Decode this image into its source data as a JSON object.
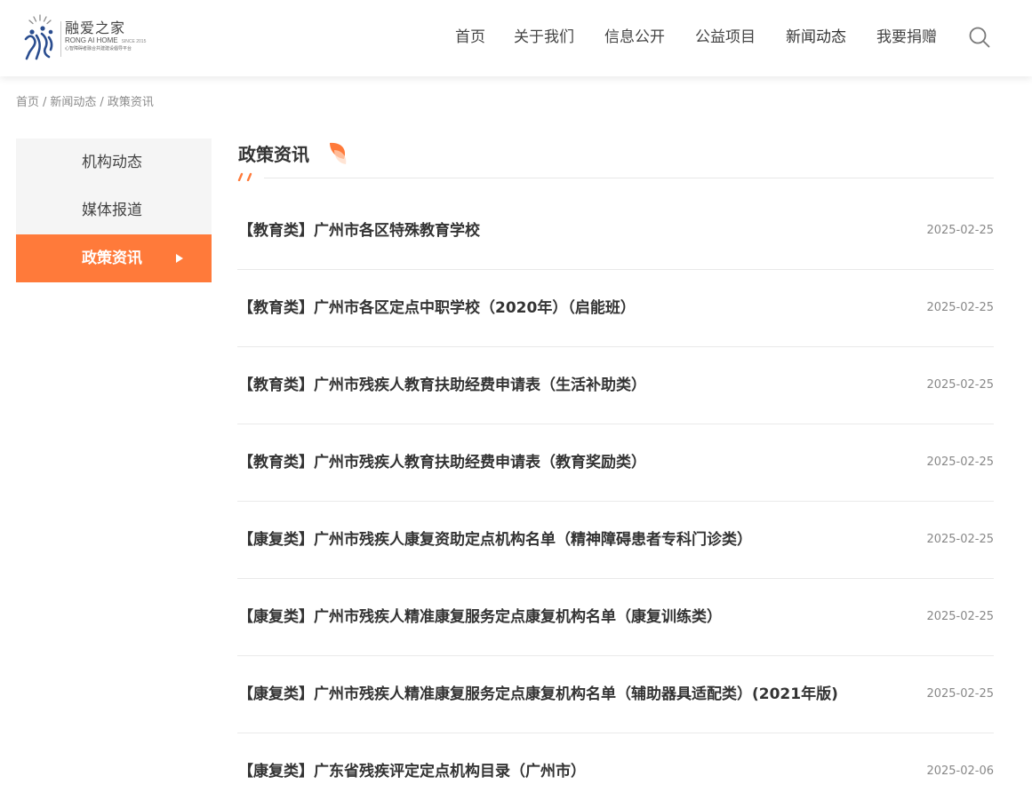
{
  "header": {
    "logo": {
      "name_cn": "融爱之家",
      "name_en": "RONG AI HOME",
      "since": "SINCE 2015",
      "slogan": "心智障碍者融合共建建设倡导平台"
    },
    "nav": [
      {
        "label": "首页"
      },
      {
        "label": "关于我们"
      },
      {
        "label": "信息公开"
      },
      {
        "label": "公益项目"
      },
      {
        "label": "新闻动态",
        "active": true
      },
      {
        "label": "我要捐赠"
      }
    ],
    "search_icon": "search-icon"
  },
  "breadcrumb": [
    "首页",
    "新闻动态",
    "政策资讯"
  ],
  "sidebar": {
    "items": [
      {
        "label": "机构动态"
      },
      {
        "label": "媒体报道"
      },
      {
        "label": "政策资讯",
        "active": true
      }
    ]
  },
  "main": {
    "section_title": "政策资讯",
    "items": [
      {
        "title": "【教育类】广州市各区特殊教育学校",
        "date": "2025-02-25"
      },
      {
        "title": "【教育类】广州市各区定点中职学校（2020年）（启能班）",
        "date": "2025-02-25"
      },
      {
        "title": "【教育类】广州市残疾人教育扶助经费申请表（生活补助类）",
        "date": "2025-02-25"
      },
      {
        "title": "【教育类】广州市残疾人教育扶助经费申请表（教育奖励类）",
        "date": "2025-02-25"
      },
      {
        "title": "【康复类】广州市残疾人康复资助定点机构名单（精神障碍患者专科门诊类）",
        "date": "2025-02-25"
      },
      {
        "title": "【康复类】广州市残疾人精准康复服务定点康复机构名单（康复训练类）",
        "date": "2025-02-25"
      },
      {
        "title": "【康复类】广州市残疾人精准康复服务定点康复机构名单（辅助器具适配类）(2021年版)",
        "date": "2025-02-25"
      },
      {
        "title": "【康复类】广东省残疾评定定点机构目录（广州市）",
        "date": "2025-02-06"
      }
    ]
  },
  "colors": {
    "accent": "#ff7a3a",
    "sidebar_bg": "#f5f5f5",
    "logo_blue": "#2a4d8f"
  }
}
